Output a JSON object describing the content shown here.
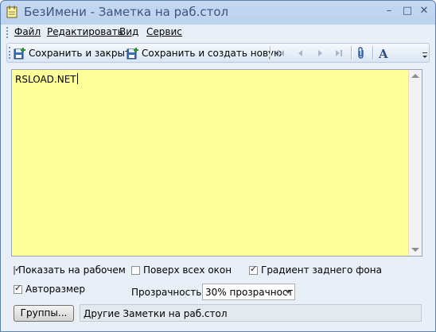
{
  "window": {
    "title": "БезИмени - Заметка на раб.стол",
    "controls": {
      "minimize": "–",
      "maximize": "□",
      "close": "✕"
    }
  },
  "menu": {
    "items": [
      {
        "label": "Файл"
      },
      {
        "label": "Редактировать"
      },
      {
        "label": "Вид"
      },
      {
        "label": "Сервис"
      }
    ]
  },
  "toolbar": {
    "save_close": "Сохранить и закрыть",
    "save_new": "Сохранить и создать новую",
    "icons": [
      "first-icon",
      "previous-icon",
      "next-icon",
      "last-icon",
      "paperclip-icon",
      "font-icon"
    ]
  },
  "editor": {
    "text": "RSLOAD.NET",
    "background": "#ffff99"
  },
  "options": {
    "show_on_desktop": {
      "label": "Показать на рабочем с",
      "checked": true
    },
    "on_top": {
      "label": "Поверх всех окон",
      "checked": false
    },
    "gradient": {
      "label": "Градиент заднего фона",
      "checked": true
    },
    "autosize": {
      "label": "Авторазмер",
      "checked": true
    },
    "transparency_label": "Прозрачность:",
    "transparency_value": "30% прозрачност"
  },
  "groups": {
    "button_label": "Группы...",
    "value": "Другие Заметки на раб.стол"
  }
}
